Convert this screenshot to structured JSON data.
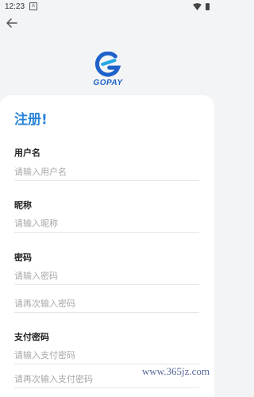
{
  "status_bar": {
    "time": "12:23",
    "badge": "A"
  },
  "logo": {
    "text": "GOPAY",
    "colors": {
      "primary": "#1e62c9",
      "accent": "#25a9e6"
    }
  },
  "form": {
    "title": "注册!",
    "username": {
      "label": "用户名",
      "placeholder": "请输入用户名"
    },
    "nickname": {
      "label": "昵称",
      "placeholder": "请输入昵称"
    },
    "password": {
      "label": "密码",
      "placeholder": "请输入密码",
      "confirm_placeholder": "请再次输入密码"
    },
    "pay_password": {
      "label": "支付密码",
      "placeholder": "请输入支付密码",
      "confirm_placeholder": "请再次输入支付密码"
    }
  },
  "watermark": "www.365jz.com"
}
